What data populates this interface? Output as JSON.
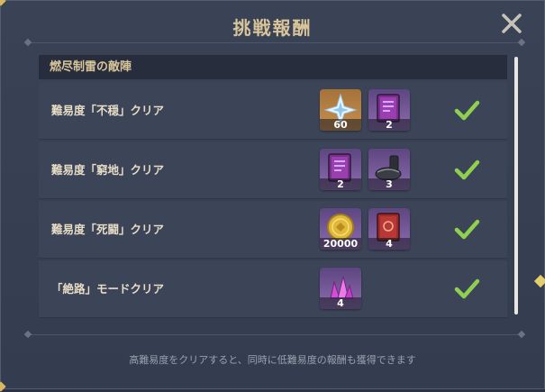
{
  "dialog": {
    "title": "挑戦報酬",
    "close_icon": "close-icon"
  },
  "section": {
    "title": "燃尽制雷の敵陣"
  },
  "rows": [
    {
      "label": "難易度「不穏」クリア",
      "completed": true,
      "rewards": [
        {
          "icon": "primogem-icon",
          "count": "60",
          "rarity": "gold"
        },
        {
          "icon": "hero-wit-book-icon",
          "count": "2",
          "rarity": "purple"
        }
      ]
    },
    {
      "label": "難易度「窮地」クリア",
      "completed": true,
      "rewards": [
        {
          "icon": "hero-wit-book-icon",
          "count": "2",
          "rarity": "purple"
        },
        {
          "icon": "ore-material-icon",
          "count": "3",
          "rarity": "purple"
        }
      ]
    },
    {
      "label": "難易度「死闘」クリア",
      "completed": true,
      "rewards": [
        {
          "icon": "mora-coin-icon",
          "count": "20000",
          "rarity": "purple"
        },
        {
          "icon": "red-book-icon",
          "count": "4",
          "rarity": "purple"
        }
      ]
    },
    {
      "label": "「絶路」モードクリア",
      "completed": true,
      "rewards": [
        {
          "icon": "crystal-ore-icon",
          "count": "4",
          "rarity": "purple"
        }
      ]
    }
  ],
  "footer": {
    "note": "高難易度をクリアすると、同時に低難易度の報酬も獲得できます"
  },
  "colors": {
    "background": "#3a4256",
    "title_text": "#d8c59a",
    "row_text": "#e7dcc6",
    "check_green": "#8fd14f",
    "gold_tile": "#b88345",
    "purple_tile": "#8e6cb0"
  }
}
